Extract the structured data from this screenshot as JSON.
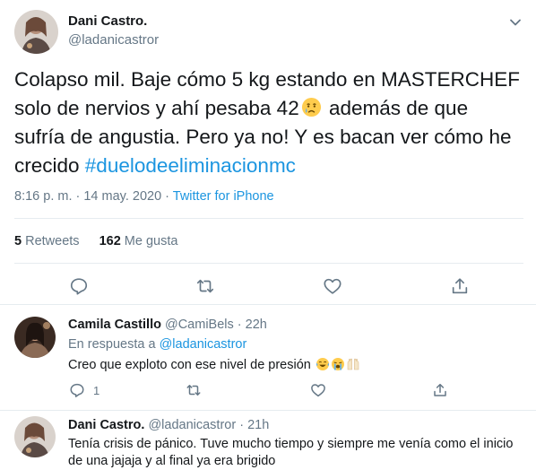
{
  "tweet": {
    "author_name": "Dani Castro.",
    "author_handle": "@ladanicastror",
    "text_line1": "Colapso mil. Baje cómo 5 kg estando en MASTERCHEF",
    "text_line2a": "solo de nervios y ahí pesaba 42",
    "text_line2b": " además de que",
    "text_line3": "sufría de angustia. Pero ya no! Y es bacan ver cómo he",
    "text_line4": "crecido ",
    "hashtag": "#duelodeeliminacionmc",
    "time": "8:16 p. m. · 14 may. 2020 · ",
    "source": "Twitter for iPhone",
    "retweets_count": "5",
    "retweets_label": " Retweets",
    "likes_count": "162",
    "likes_label": " Me gusta",
    "emoji": "crying-face"
  },
  "replies": [
    {
      "name": "Camila Castillo",
      "handle_time": " @CamiBels · 22h",
      "in_response_label": "En respuesta a ",
      "in_response_handle": "@ladanicastror",
      "text": "Creo que exploto con ese nivel de presión",
      "emojis": [
        "tears-of-joy",
        "loudly-crying",
        "raised-hands"
      ],
      "reply_count": "1"
    },
    {
      "name": "Dani Castro.",
      "handle_time": " @ladanicastror · 21h",
      "text_line1": "Tenía crisis de pánico. Tuve mucho tiempo y siempre me venía como el inicio",
      "text_line2": "de una jajaja y al final ya era brigido"
    }
  ],
  "colors": {
    "accent": "#1b95e0",
    "secondary_text": "#657786",
    "primary_text": "#14171a",
    "divider": "#e6ecf0"
  }
}
